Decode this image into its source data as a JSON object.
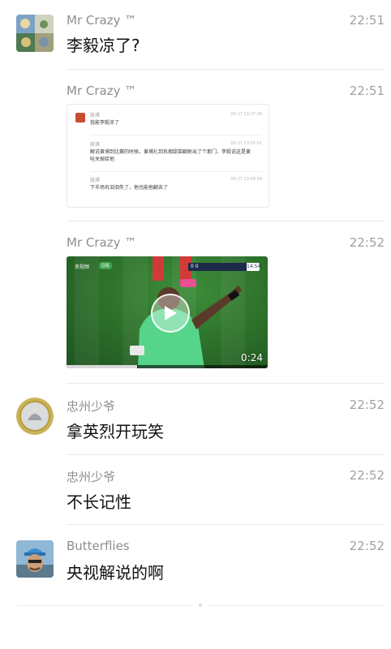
{
  "messages": [
    {
      "sender": "Mr Crazy ™",
      "time": "22:51",
      "text": "李毅凉了?"
    },
    {
      "sender": "Mr Crazy ™",
      "time": "22:51",
      "quote": {
        "items": [
          {
            "name": "凯琪",
            "time": "06-17 13:37:28",
            "text": "我能李毅凉了"
          },
          {
            "name": "凯琪",
            "time": "06-17 13:55:01",
            "text": "解说黄埔到比赛的时候，黄埔扎到巩拥甜菜翻射出了个那门、李毅说这是黄哇关掉给他"
          },
          {
            "name": "凯琪",
            "time": "06-17 13:58:58",
            "text": "下半场巩泪泪失了，他也能他翻去了"
          }
        ]
      }
    },
    {
      "sender": "Mr Crazy ™",
      "time": "22:52",
      "video": {
        "duration": "0:24",
        "channel": "央视频",
        "badge": "回看",
        "score": "0 0",
        "clock": "14:54",
        "progress": 0.35
      }
    },
    {
      "sender": "忠州少爷",
      "time": "22:52",
      "text": "拿英烈开玩笑"
    },
    {
      "sender": "忠州少爷",
      "time": "22:52",
      "text": "不长记性"
    },
    {
      "sender": "Butterflies",
      "time": "22:52",
      "text": "央视解说的啊"
    }
  ],
  "colors": {
    "sender": "#8e8e8e",
    "time": "#a0a0a0",
    "text": "#111111",
    "separator": "#e9e9e9"
  }
}
